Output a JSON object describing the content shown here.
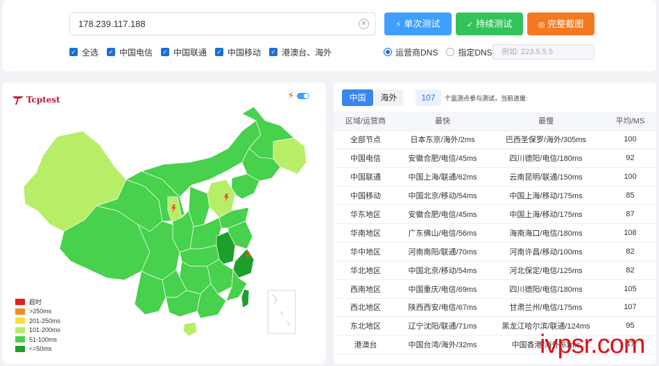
{
  "search": {
    "ip_value": "178.239.117.188",
    "clear_icon": "x-circle-icon"
  },
  "buttons": {
    "single_test": "单次测试",
    "continuous_test": "持续测试",
    "full_screenshot": "完整截图",
    "single_icon": "bolt-icon",
    "continuous_icon": "check-icon",
    "screenshot_icon": "camera-icon"
  },
  "filters": [
    {
      "label": "全选",
      "checked": true
    },
    {
      "label": "中国电信",
      "checked": true
    },
    {
      "label": "中国联通",
      "checked": true
    },
    {
      "label": "中国移动",
      "checked": true
    },
    {
      "label": "港澳台、海外",
      "checked": true
    }
  ],
  "dns": {
    "option_carrier": "运营商DNS",
    "option_custom": "指定DNS:",
    "selected": "运营商DNS",
    "placeholder": "例如: 223.5.5.5"
  },
  "map": {
    "logo_text": "Tcptest",
    "legend": [
      {
        "label": "超时",
        "color": "#e01e1e"
      },
      {
        "label": ">250ms",
        "color": "#f48c1c"
      },
      {
        "label": "201-250ms",
        "color": "#f2e13a"
      },
      {
        "label": "101-200ms",
        "color": "#b8ee67"
      },
      {
        "label": "51-100ms",
        "color": "#47d14c"
      },
      {
        "label": "<=50ms",
        "color": "#1e9e2c"
      }
    ]
  },
  "results": {
    "tabs": [
      "中国",
      "海外"
    ],
    "active_tab": "中国",
    "node_count": "107",
    "count_text": "个监测点参与测试，当前进度:",
    "columns": [
      "区域/运营商",
      "最快",
      "最慢",
      "平均/MS"
    ],
    "rows": [
      [
        "全部节点",
        "日本东京/海外/2ms",
        "巴西圣保罗/海外/305ms",
        "100"
      ],
      [
        "中国电信",
        "安徽合肥/电信/45ms",
        "四川德阳/电信/180ms",
        "92"
      ],
      [
        "中国联通",
        "中国上海/联通/62ms",
        "云南昆明/联通/150ms",
        "100"
      ],
      [
        "中国移动",
        "中国北京/移动/54ms",
        "中国上海/移动/175ms",
        "85"
      ],
      [
        "华东地区",
        "安徽合肥/电信/45ms",
        "中国上海/移动/175ms",
        "87"
      ],
      [
        "华南地区",
        "广东佛山/电信/56ms",
        "海南海口/电信/180ms",
        "108"
      ],
      [
        "华中地区",
        "河南南阳/联通/70ms",
        "河南许昌/移动/100ms",
        "82"
      ],
      [
        "华北地区",
        "中国北京/移动/54ms",
        "河北保定/电信/125ms",
        "82"
      ],
      [
        "西南地区",
        "中国重庆/电信/69ms",
        "四川德阳/电信/180ms",
        "105"
      ],
      [
        "西北地区",
        "陕西西安/电信/67ms",
        "甘肃兰州/电信/175ms",
        "107"
      ],
      [
        "东北地区",
        "辽宁沈阳/联通/71ms",
        "黑龙江哈尔滨/联通/124ms",
        "95"
      ],
      [
        "港澳台",
        "中国台湾/海外/32ms",
        "中国香港/海外/61ms",
        "47"
      ]
    ]
  },
  "watermark": "ivpsr.com"
}
